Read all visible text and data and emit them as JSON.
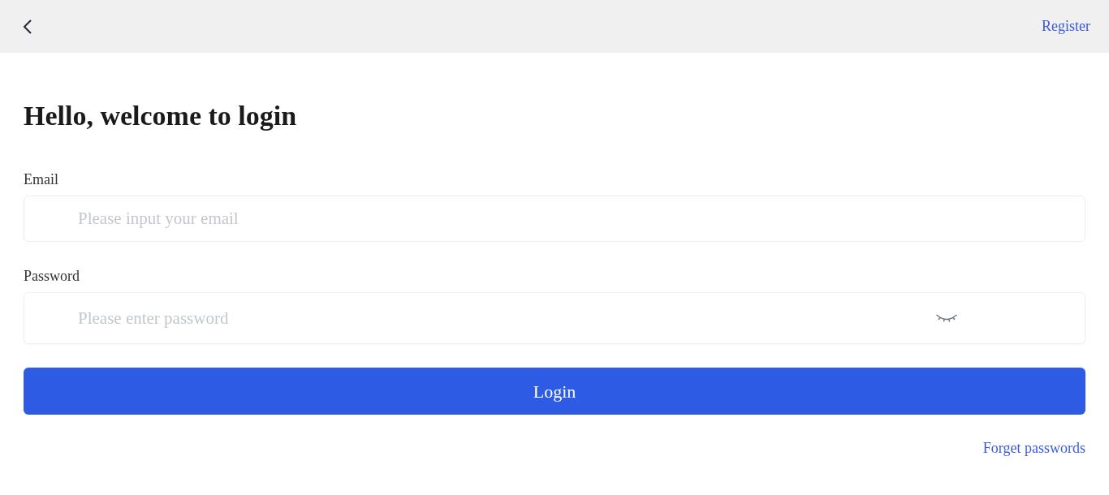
{
  "header": {
    "register_link": "Register"
  },
  "title": "Hello, welcome to login",
  "email": {
    "label": "Email",
    "placeholder": "Please input your email"
  },
  "password": {
    "label": "Password",
    "placeholder": "Please enter password",
    "visible": false
  },
  "login_button": "Login",
  "forget_link": "Forget passwords"
}
